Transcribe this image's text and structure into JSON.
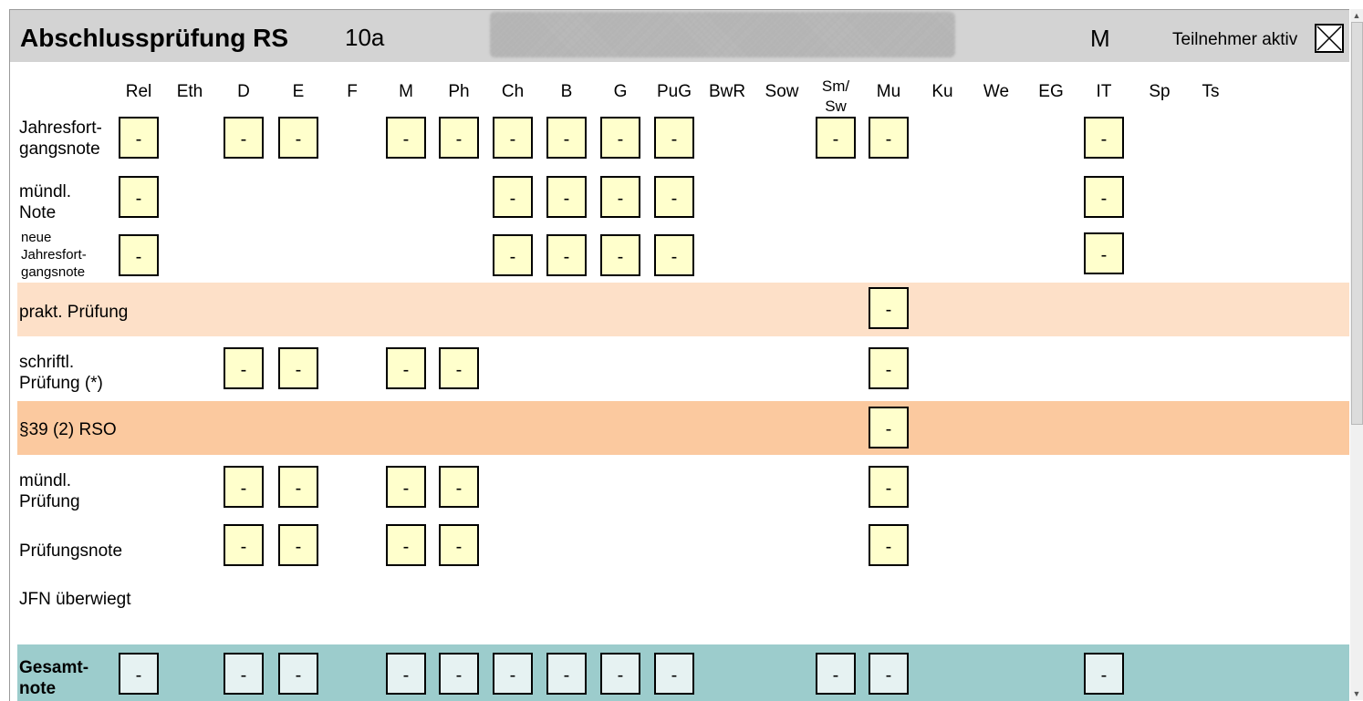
{
  "header": {
    "title": "Abschlussprüfung RS",
    "class": "10a",
    "gender": "M",
    "active_label": "Teilnehmer aktiv",
    "active_checked": true
  },
  "subjects": [
    "Rel",
    "Eth",
    "D",
    "E",
    "F",
    "M",
    "Ph",
    "Ch",
    "B",
    "G",
    "PuG",
    "BwR",
    "Sow",
    "Sm/\nSw",
    "Mu",
    "Ku",
    "We",
    "EG",
    "IT",
    "Sp",
    "Ts"
  ],
  "rows": [
    {
      "label": "Jahresfort-\ngangsnote",
      "cells": [
        "Rel",
        "D",
        "E",
        "M",
        "Ph",
        "Ch",
        "B",
        "G",
        "PuG",
        "Sm/\nSw",
        "Mu",
        "IT"
      ]
    },
    {
      "label": "mündl.\nNote",
      "cells": [
        "Rel",
        "Ch",
        "B",
        "G",
        "PuG",
        "IT"
      ]
    },
    {
      "label": "neue\nJahresfort-\ngangsnote",
      "cells": [
        "Rel",
        "Ch",
        "B",
        "G",
        "PuG",
        "IT"
      ]
    },
    {
      "label": "prakt. Prüfung",
      "cells": [
        "Mu"
      ]
    },
    {
      "label": "schriftl.\nPrüfung (*)",
      "cells": [
        "D",
        "E",
        "M",
        "Ph",
        "Mu"
      ]
    },
    {
      "label": "§39 (2) RSO",
      "cells": [
        "Mu"
      ]
    },
    {
      "label": "mündl.\nPrüfung",
      "cells": [
        "D",
        "E",
        "M",
        "Ph",
        "Mu"
      ]
    },
    {
      "label": "Prüfungsnote",
      "cells": [
        "D",
        "E",
        "M",
        "Ph",
        "Mu"
      ]
    },
    {
      "label": "JFN überwiegt",
      "cells": []
    },
    {
      "label": "Gesamt-\nnote",
      "cells": [
        "Rel",
        "D",
        "E",
        "M",
        "Ph",
        "Ch",
        "B",
        "G",
        "PuG",
        "Sm/\nSw",
        "Mu",
        "IT"
      ]
    }
  ],
  "cell_value": "-",
  "colors": {
    "header_bg": "#d3d3d3",
    "cell_bg": "#ffffcc",
    "prakt_band": "#fde0c8",
    "para_band": "#fbc99f",
    "gesamt_band": "#9ccccc",
    "gesamt_cell_bg": "#e6f2f2"
  }
}
